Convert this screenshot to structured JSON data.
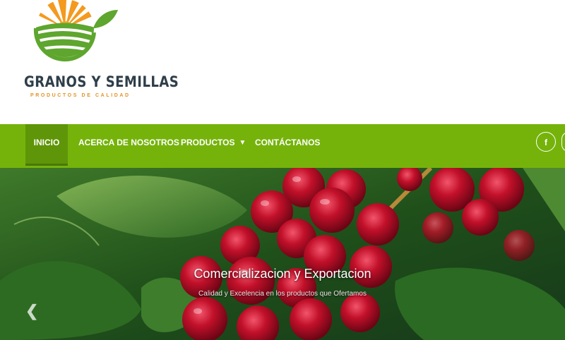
{
  "brand": {
    "name": "GRANOS Y SEMILLAS",
    "tagline": "PRODUCTOS DE CALIDAD"
  },
  "nav": {
    "items": [
      {
        "label": "INICIO",
        "active": true
      },
      {
        "label": "ACERCA DE NOSOTROS"
      },
      {
        "label": "PRODUCTOS",
        "dropdown": true
      },
      {
        "label": "CONTÁCTANOS"
      }
    ],
    "social_facebook": "f"
  },
  "hero": {
    "title": "Comercializacion y Exportacion",
    "subtitle": "Calidad y Excelencia en los productos que Ofertamos",
    "prev_arrow": "❮"
  },
  "colors": {
    "nav_green": "#75b30b",
    "brand_orange": "#e49223",
    "brand_dark": "#2f3f4a"
  }
}
